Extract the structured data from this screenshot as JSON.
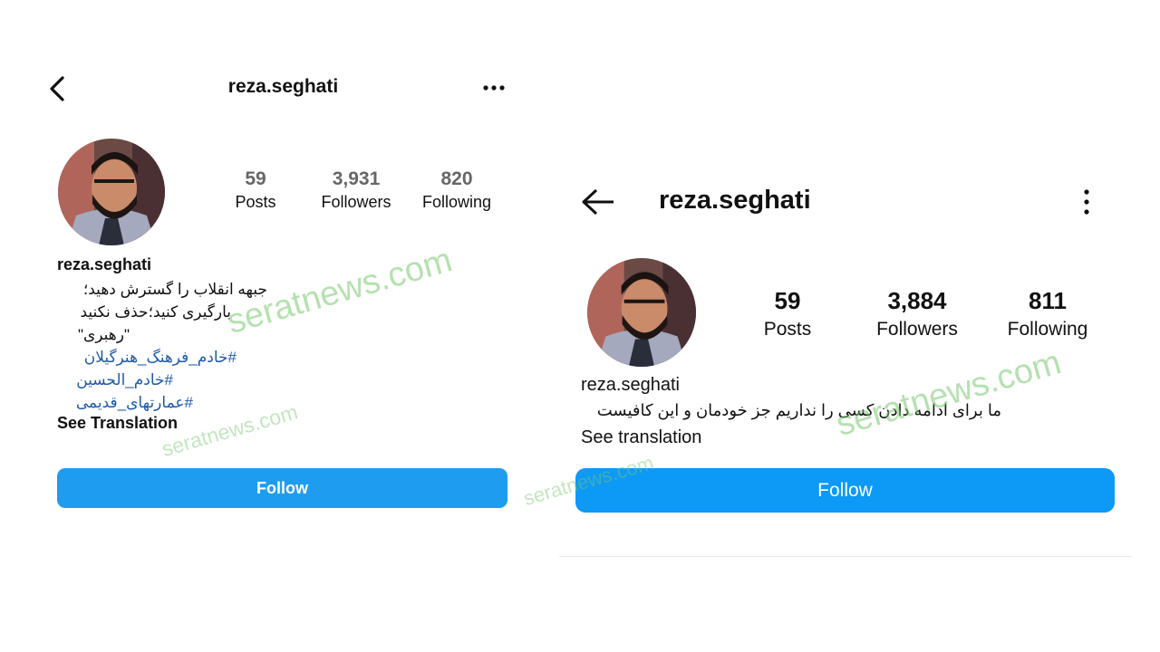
{
  "left": {
    "username_title": "reza.seghati",
    "stats": {
      "posts_count": "59",
      "posts_label": "Posts",
      "followers_count": "3,931",
      "followers_label": "Followers",
      "following_count": "820",
      "following_label": "Following"
    },
    "display_name": "reza.seghati",
    "bio_lines": [
      "جبهه انقلاب را گسترش دهید؛",
      "بارگیری کنید؛حذف نکنید",
      "\"رهبری\""
    ],
    "hashtags": [
      "#خادم_فرهنگ_هنرگیلان",
      "#خادم_الحسین",
      "#عمارتهای_قدیمی"
    ],
    "see_translation": "See Translation",
    "follow_label": "Follow"
  },
  "right": {
    "username_title": "reza.seghati",
    "stats": {
      "posts_count": "59",
      "posts_label": "Posts",
      "followers_count": "3,884",
      "followers_label": "Followers",
      "following_count": "811",
      "following_label": "Following"
    },
    "display_name": "reza.seghati",
    "bio": "ما برای ادامه دادن کسی را نداریم جز خودمان و این کافیست",
    "see_translation": "See translation",
    "follow_label": "Follow"
  },
  "watermarks": [
    "seratnews.com",
    "seratnews.com",
    "seratnews.com",
    "seratnews.com"
  ],
  "icons": {
    "left_back": "chevron-left-icon",
    "left_more": "horizontal-dots-icon",
    "right_back": "arrow-left-icon",
    "right_more": "vertical-dots-icon"
  },
  "colors": {
    "follow_left": "#1e9df0",
    "follow_right": "#0d99f6",
    "hashtag": "#1d5aa8",
    "watermark": "#78c86e"
  }
}
